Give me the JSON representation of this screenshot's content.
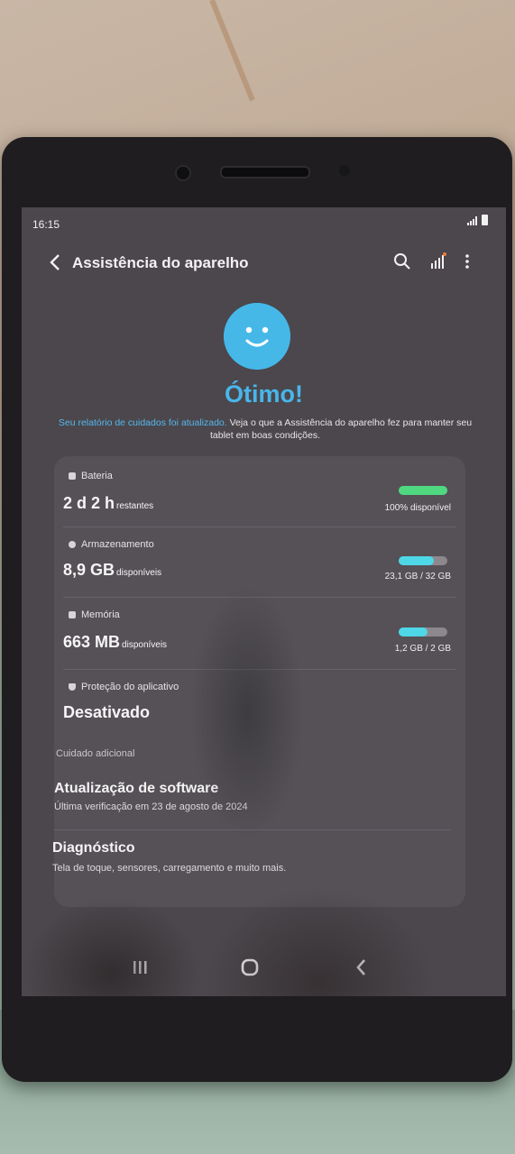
{
  "status_bar": {
    "time": "16:15"
  },
  "app_bar": {
    "title": "Assistência do aparelho",
    "icons": [
      "back-icon",
      "search-icon",
      "signal-chart-icon",
      "more-vert-icon"
    ]
  },
  "summary": {
    "status": "Ótimo!",
    "report_link": "Seu relatório de cuidados foi atualizado.",
    "report_text": " Veja o que a Assistência do aparelho fez para manter seu tablet em boas condições."
  },
  "items": [
    {
      "label": "Bateria",
      "value": "2 d 2 h",
      "unit": "restantes",
      "bar_fraction": 1.0,
      "bar_color": "#4fd880",
      "detail": "100% disponível"
    },
    {
      "label": "Armazenamento",
      "value": "8,9 GB",
      "unit": "disponíveis",
      "bar_fraction": 0.72,
      "bar_color": "#4ed7e6",
      "detail": "23,1 GB / 32 GB"
    },
    {
      "label": "Memória",
      "value": "663 MB",
      "unit": "disponíveis",
      "bar_fraction": 0.6,
      "bar_color": "#4ed7e6",
      "detail": "1,2 GB / 2 GB"
    },
    {
      "label": "Proteção do aplicativo",
      "value": "Desativado"
    }
  ],
  "additional": {
    "section_title": "Cuidado adicional",
    "software_update": {
      "title": "Atualização de software",
      "subtitle": "Última verificação em 23 de agosto de 2024"
    },
    "diagnostics": {
      "title": "Diagnóstico",
      "subtitle": "Tela de toque, sensores, carregamento e muito mais."
    }
  },
  "nav_bar": {
    "icons": [
      "recents-icon",
      "home-icon",
      "back-nav-icon"
    ]
  }
}
